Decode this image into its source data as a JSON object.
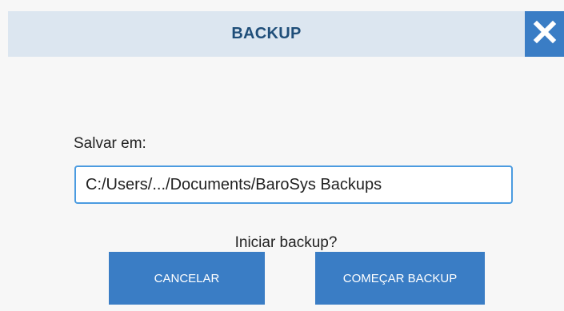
{
  "dialog": {
    "title": "BACKUP",
    "close_icon": "close-icon"
  },
  "form": {
    "save_label": "Salvar em:",
    "path_value": "C:/Users/.../Documents/BaroSys Backups"
  },
  "prompt": "Iniciar backup?",
  "buttons": {
    "cancel_label": "CANCELAR",
    "start_label": "COMEÇAR BACKUP"
  },
  "colors": {
    "accent": "#3a7dc5",
    "titlebar_bg": "#dce6f0",
    "title_text": "#1f4e79",
    "input_border": "#4b9be0"
  }
}
